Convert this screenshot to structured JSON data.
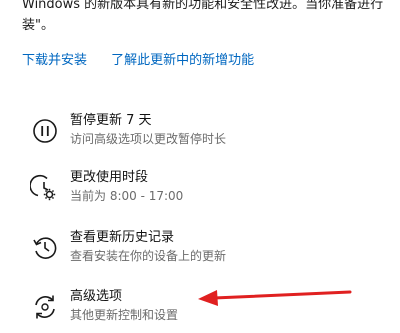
{
  "colors": {
    "accent": "#0067c0",
    "annotation_arrow": "#e02020",
    "subtitle": "#6b6b6b"
  },
  "intro": {
    "line1": "Windows 的新版本具有新的功能和安全性改进。当你准备进行",
    "line2": "装\"。"
  },
  "links": {
    "download": "下载并安装",
    "learn_more": "了解此更新中的新增功能"
  },
  "options": [
    {
      "icon": "pause-icon",
      "title": "暂停更新 7 天",
      "subtitle": "访问高级选项以更改暂停时长"
    },
    {
      "icon": "clock-gear-icon",
      "title": "更改使用时段",
      "subtitle": "当前为 8:00 - 17:00"
    },
    {
      "icon": "history-icon",
      "title": "查看更新历史记录",
      "subtitle": "查看安装在你的设备上的更新"
    },
    {
      "icon": "advanced-options-icon",
      "title": "高级选项",
      "subtitle": "其他更新控制和设置"
    }
  ]
}
